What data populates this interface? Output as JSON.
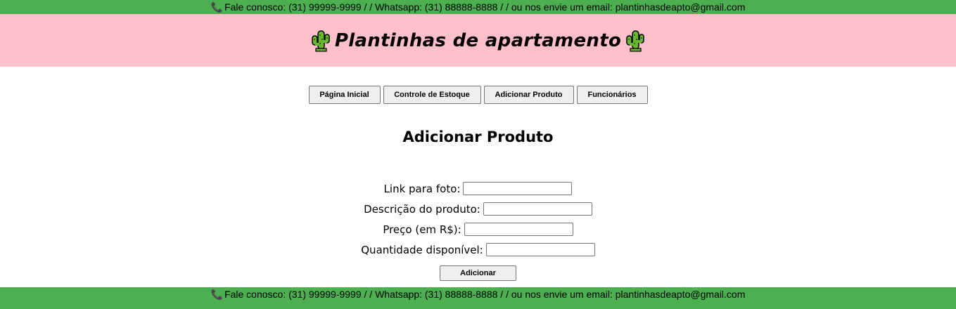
{
  "contact": {
    "text": "Fale conosco: (31) 99999-9999 / / Whatsapp: (31) 88888-8888 / / ou nos envie um email: plantinhasdeapto@gmail.com",
    "icon": "phone-icon"
  },
  "header": {
    "title": "Plantinhas de apartamento",
    "icon": "cactus-icon",
    "background": "#ffc0cb"
  },
  "nav": {
    "items": [
      "Página Inicial",
      "Controle de Estoque",
      "Adicionar Produto",
      "Funcionários"
    ]
  },
  "page": {
    "title": "Adicionar Produto"
  },
  "form": {
    "fields": [
      {
        "label": "Link para foto:",
        "value": ""
      },
      {
        "label": "Descrição do produto:",
        "value": ""
      },
      {
        "label": "Preço (em R$):",
        "value": ""
      },
      {
        "label": "Quantidade disponível:",
        "value": ""
      }
    ],
    "submit_label": "Adicionar"
  },
  "colors": {
    "bar": "#4caf50",
    "banner": "#ffc0cb"
  }
}
